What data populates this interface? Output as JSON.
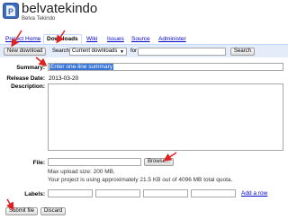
{
  "project": {
    "name": "belvatekindo",
    "summary": "Belva Tekindo"
  },
  "tabs": [
    {
      "label": "Project Home",
      "active": false
    },
    {
      "label": "Downloads",
      "active": true
    },
    {
      "label": "Wiki",
      "active": false
    },
    {
      "label": "Issues",
      "active": false
    },
    {
      "label": "Source",
      "active": false
    },
    {
      "label": "Administer",
      "active": false
    }
  ],
  "toolbar": {
    "new_download_label": "New download",
    "search_label": "Search",
    "scope_value": "Current downloads",
    "for_label": "for",
    "search_button_label": "Search"
  },
  "form": {
    "summary_label": "Summary:",
    "summary_value": "Enter one-line summary",
    "release_date_label": "Release Date:",
    "release_date_value": "2013-03-20",
    "description_label": "Description:",
    "file_label": "File:",
    "browse_label": "Browse...",
    "max_upload": "Max upload size: 200 MB.",
    "usage": "Your project is using approximately 21.5 KB out of 4096 MB total quota.",
    "labels_label": "Labels:",
    "add_row_label": "Add a row",
    "submit_label": "Submit file",
    "discard_label": "Discard"
  },
  "colors": {
    "accent": "#c3d9ff",
    "bar": "#e5ecf9",
    "arrow": "#e02020",
    "link": "#0000cc"
  }
}
